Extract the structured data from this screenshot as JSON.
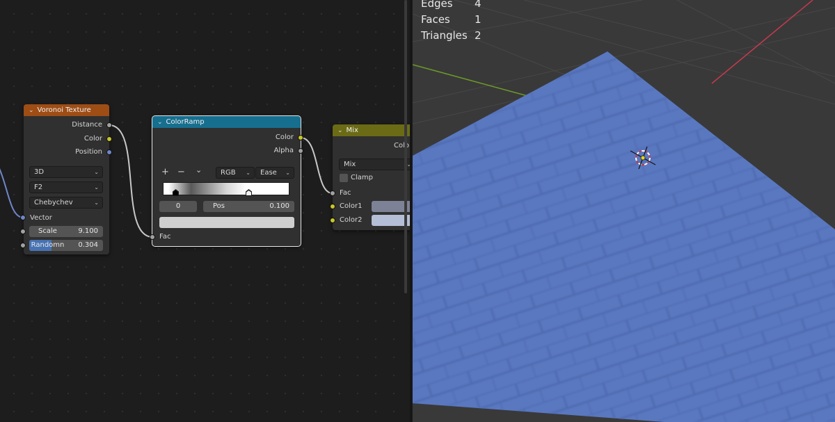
{
  "voronoi": {
    "title": "Voronoi Texture",
    "outputs": [
      "Distance",
      "Color",
      "Position"
    ],
    "dimensions": "3D",
    "feature": "F2",
    "metric": "Chebychev",
    "vector_label": "Vector",
    "scale_label": "Scale",
    "scale_value": "9.100",
    "randomness_label": "Randomn",
    "randomness_value": "0.304",
    "randomness_fraction": 0.304
  },
  "colorramp": {
    "title": "ColorRamp",
    "outputs": [
      "Color",
      "Alpha"
    ],
    "add": "+",
    "remove": "−",
    "menu": "⌄",
    "color_mode": "RGB",
    "interpolation": "Ease",
    "index": "0",
    "pos_label": "Pos",
    "pos_value": "0.100",
    "fac_label": "Fac"
  },
  "mix": {
    "title": "Mix",
    "output": "Colo",
    "blend": "Mix",
    "clamp_label": "Clamp",
    "fac_label": "Fac",
    "color1_label": "Color1",
    "color2_label": "Color2",
    "color1": "#7d8296",
    "color2": "#b4bed7"
  },
  "stats": [
    {
      "label": "Edges",
      "value": "4"
    },
    {
      "label": "Faces",
      "value": "1"
    },
    {
      "label": "Triangles",
      "value": "2"
    }
  ],
  "colors": {
    "voronoi_header": "#9e4d15",
    "colorramp_header": "#176f8f",
    "mix_header": "#6b6b16",
    "plane": "#5a78c0",
    "x_axis": "#c43a4c",
    "y_axis": "#6e9a28"
  },
  "icons": {
    "collapse": "chevron-down-icon",
    "cursor": "3d-cursor-icon"
  }
}
